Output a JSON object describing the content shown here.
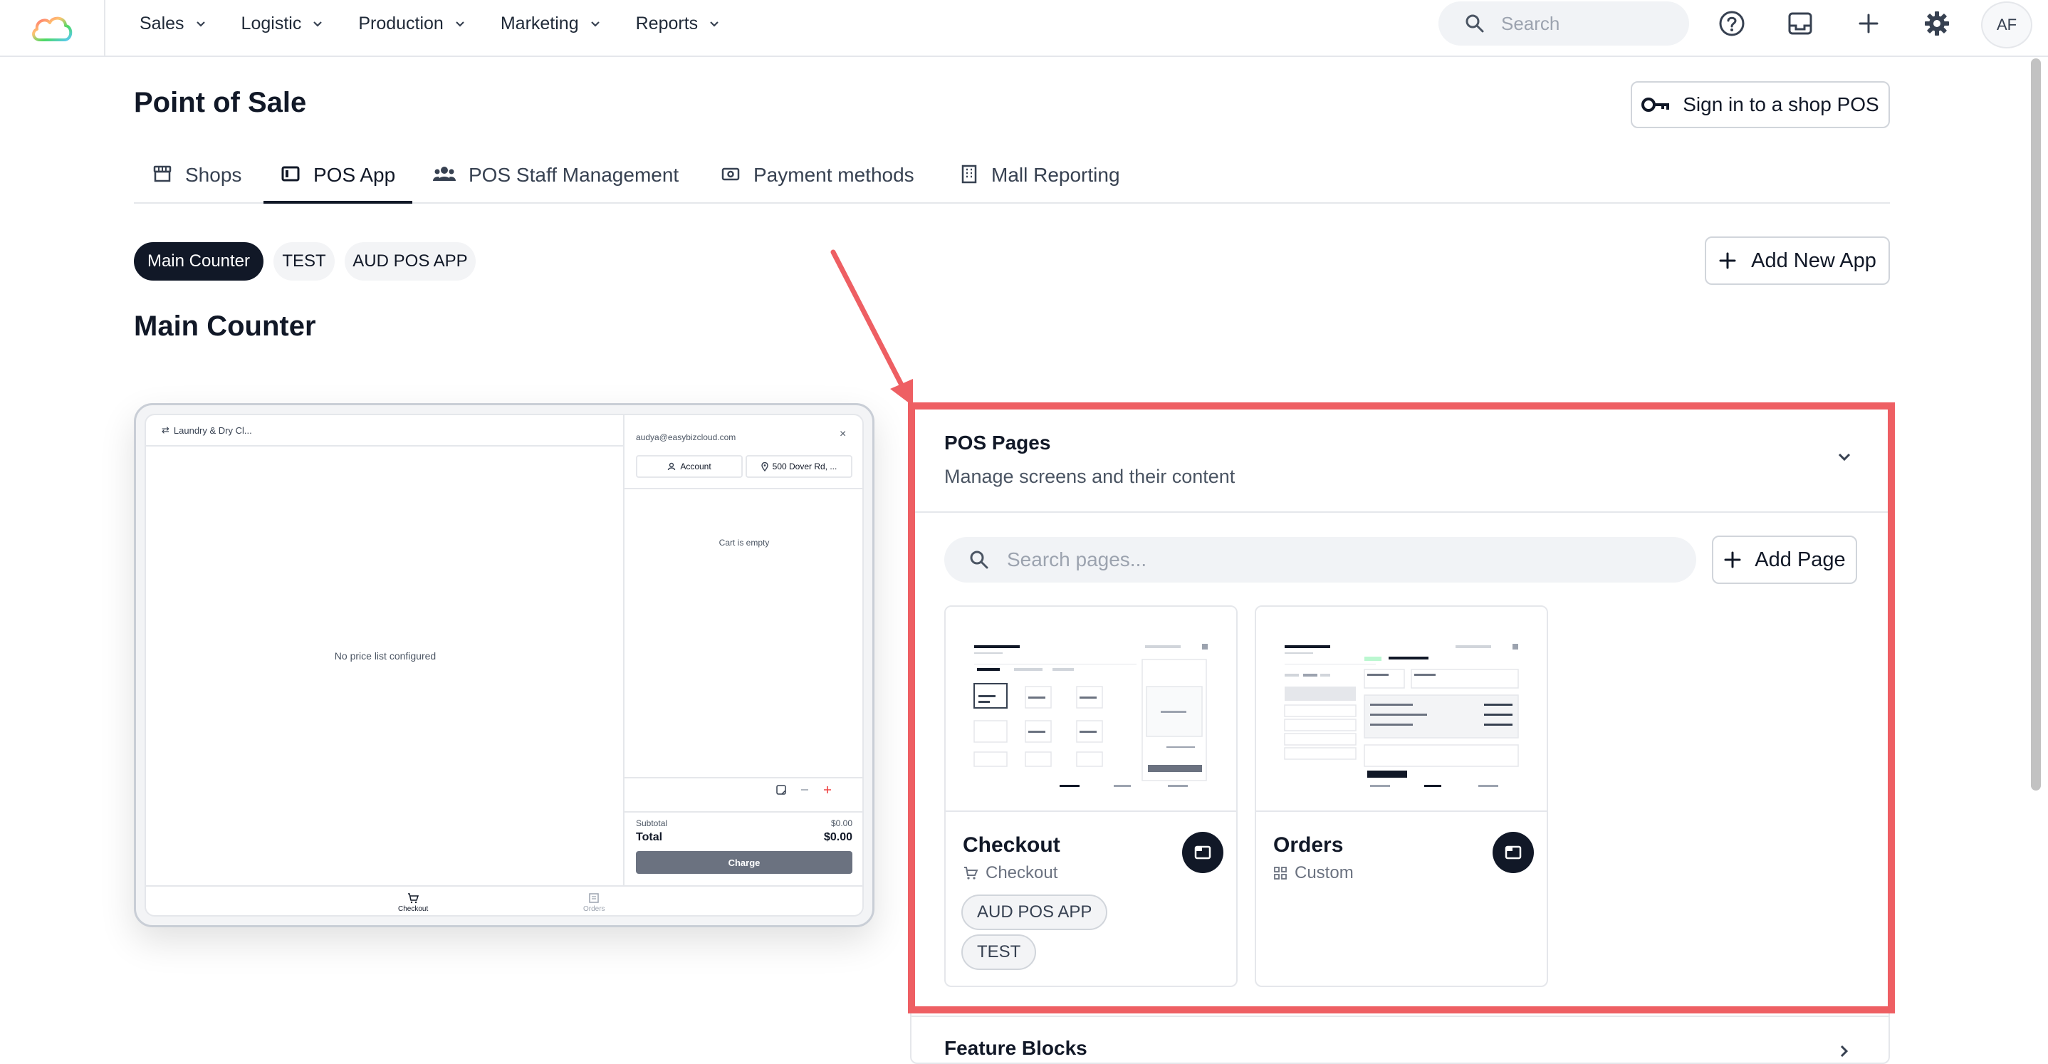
{
  "nav": {
    "menu": [
      {
        "label": "Sales"
      },
      {
        "label": "Logistic"
      },
      {
        "label": "Production"
      },
      {
        "label": "Marketing"
      },
      {
        "label": "Reports"
      }
    ],
    "search_placeholder": "Search",
    "avatar_initials": "AF",
    "icons": [
      "cloud-logo-icon",
      "search-icon",
      "help-icon",
      "inbox-icon",
      "plus-icon",
      "gear-icon"
    ]
  },
  "header": {
    "title": "Point of Sale",
    "signin_label": "Sign in to a shop POS"
  },
  "tabs": [
    {
      "label": "Shops",
      "icon": "store-icon",
      "active": false
    },
    {
      "label": "POS App",
      "icon": "tablet-icon",
      "active": true
    },
    {
      "label": "POS Staff Management",
      "icon": "users-icon",
      "active": false
    },
    {
      "label": "Payment methods",
      "icon": "payment-icon",
      "active": false
    },
    {
      "label": "Mall Reporting",
      "icon": "building-icon",
      "active": false
    }
  ],
  "apps": {
    "pills": [
      {
        "label": "Main Counter",
        "active": true
      },
      {
        "label": "TEST",
        "active": false
      },
      {
        "label": "AUD POS APP",
        "active": false
      }
    ],
    "add_label": "Add New App",
    "current_title": "Main Counter"
  },
  "preview": {
    "shop_name": "Laundry & Dry Cl...",
    "empty_message": "No price list configured",
    "email": "audya@easybizcloud.com",
    "close_glyph": "×",
    "account_label": "Account",
    "address_label": "500 Dover Rd, ...",
    "cart_empty": "Cart is empty",
    "subtotal_label": "Subtotal",
    "subtotal_value": "$0.00",
    "total_label": "Total",
    "total_value": "$0.00",
    "charge_label": "Charge",
    "tabs": [
      {
        "label": "Checkout",
        "active": true
      },
      {
        "label": "Orders",
        "active": false
      }
    ]
  },
  "pos_pages": {
    "title": "POS Pages",
    "subtitle": "Manage screens and their content",
    "search_placeholder": "Search pages...",
    "add_label": "Add Page",
    "cards": [
      {
        "name": "Checkout",
        "type": "Checkout",
        "type_icon": "cart-icon",
        "tags": [
          "AUD POS APP",
          "TEST"
        ]
      },
      {
        "name": "Orders",
        "type": "Custom",
        "type_icon": "grid-icon",
        "tags": []
      }
    ]
  },
  "feature_blocks": {
    "title": "Feature Blocks"
  },
  "colors": {
    "accent_dark": "#111827",
    "annotation_red": "#ee5f63",
    "border": "#e5e7eb"
  }
}
